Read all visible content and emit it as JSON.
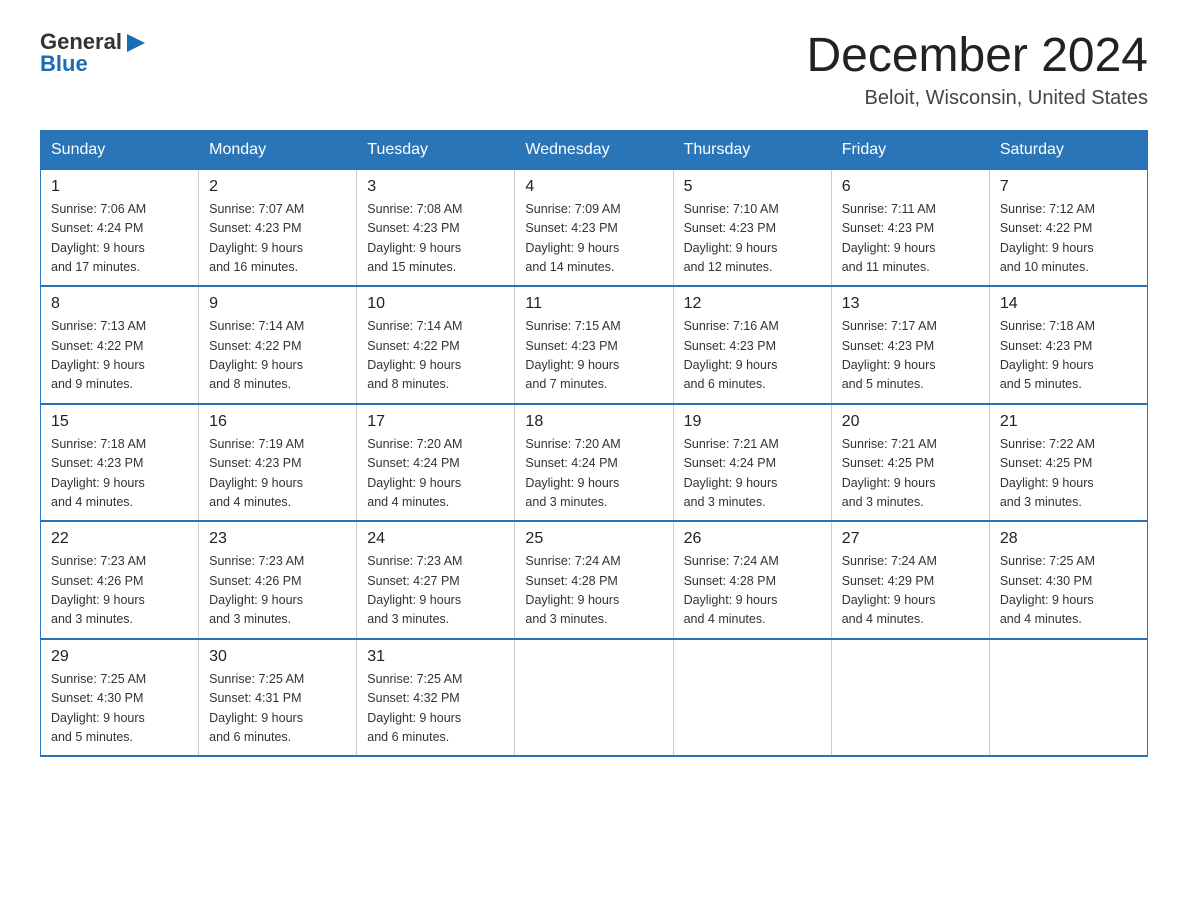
{
  "logo": {
    "general": "General",
    "blue": "Blue"
  },
  "title": "December 2024",
  "location": "Beloit, Wisconsin, United States",
  "days_of_week": [
    "Sunday",
    "Monday",
    "Tuesday",
    "Wednesday",
    "Thursday",
    "Friday",
    "Saturday"
  ],
  "weeks": [
    [
      {
        "day": "1",
        "info": "Sunrise: 7:06 AM\nSunset: 4:24 PM\nDaylight: 9 hours\nand 17 minutes."
      },
      {
        "day": "2",
        "info": "Sunrise: 7:07 AM\nSunset: 4:23 PM\nDaylight: 9 hours\nand 16 minutes."
      },
      {
        "day": "3",
        "info": "Sunrise: 7:08 AM\nSunset: 4:23 PM\nDaylight: 9 hours\nand 15 minutes."
      },
      {
        "day": "4",
        "info": "Sunrise: 7:09 AM\nSunset: 4:23 PM\nDaylight: 9 hours\nand 14 minutes."
      },
      {
        "day": "5",
        "info": "Sunrise: 7:10 AM\nSunset: 4:23 PM\nDaylight: 9 hours\nand 12 minutes."
      },
      {
        "day": "6",
        "info": "Sunrise: 7:11 AM\nSunset: 4:23 PM\nDaylight: 9 hours\nand 11 minutes."
      },
      {
        "day": "7",
        "info": "Sunrise: 7:12 AM\nSunset: 4:22 PM\nDaylight: 9 hours\nand 10 minutes."
      }
    ],
    [
      {
        "day": "8",
        "info": "Sunrise: 7:13 AM\nSunset: 4:22 PM\nDaylight: 9 hours\nand 9 minutes."
      },
      {
        "day": "9",
        "info": "Sunrise: 7:14 AM\nSunset: 4:22 PM\nDaylight: 9 hours\nand 8 minutes."
      },
      {
        "day": "10",
        "info": "Sunrise: 7:14 AM\nSunset: 4:22 PM\nDaylight: 9 hours\nand 8 minutes."
      },
      {
        "day": "11",
        "info": "Sunrise: 7:15 AM\nSunset: 4:23 PM\nDaylight: 9 hours\nand 7 minutes."
      },
      {
        "day": "12",
        "info": "Sunrise: 7:16 AM\nSunset: 4:23 PM\nDaylight: 9 hours\nand 6 minutes."
      },
      {
        "day": "13",
        "info": "Sunrise: 7:17 AM\nSunset: 4:23 PM\nDaylight: 9 hours\nand 5 minutes."
      },
      {
        "day": "14",
        "info": "Sunrise: 7:18 AM\nSunset: 4:23 PM\nDaylight: 9 hours\nand 5 minutes."
      }
    ],
    [
      {
        "day": "15",
        "info": "Sunrise: 7:18 AM\nSunset: 4:23 PM\nDaylight: 9 hours\nand 4 minutes."
      },
      {
        "day": "16",
        "info": "Sunrise: 7:19 AM\nSunset: 4:23 PM\nDaylight: 9 hours\nand 4 minutes."
      },
      {
        "day": "17",
        "info": "Sunrise: 7:20 AM\nSunset: 4:24 PM\nDaylight: 9 hours\nand 4 minutes."
      },
      {
        "day": "18",
        "info": "Sunrise: 7:20 AM\nSunset: 4:24 PM\nDaylight: 9 hours\nand 3 minutes."
      },
      {
        "day": "19",
        "info": "Sunrise: 7:21 AM\nSunset: 4:24 PM\nDaylight: 9 hours\nand 3 minutes."
      },
      {
        "day": "20",
        "info": "Sunrise: 7:21 AM\nSunset: 4:25 PM\nDaylight: 9 hours\nand 3 minutes."
      },
      {
        "day": "21",
        "info": "Sunrise: 7:22 AM\nSunset: 4:25 PM\nDaylight: 9 hours\nand 3 minutes."
      }
    ],
    [
      {
        "day": "22",
        "info": "Sunrise: 7:23 AM\nSunset: 4:26 PM\nDaylight: 9 hours\nand 3 minutes."
      },
      {
        "day": "23",
        "info": "Sunrise: 7:23 AM\nSunset: 4:26 PM\nDaylight: 9 hours\nand 3 minutes."
      },
      {
        "day": "24",
        "info": "Sunrise: 7:23 AM\nSunset: 4:27 PM\nDaylight: 9 hours\nand 3 minutes."
      },
      {
        "day": "25",
        "info": "Sunrise: 7:24 AM\nSunset: 4:28 PM\nDaylight: 9 hours\nand 3 minutes."
      },
      {
        "day": "26",
        "info": "Sunrise: 7:24 AM\nSunset: 4:28 PM\nDaylight: 9 hours\nand 4 minutes."
      },
      {
        "day": "27",
        "info": "Sunrise: 7:24 AM\nSunset: 4:29 PM\nDaylight: 9 hours\nand 4 minutes."
      },
      {
        "day": "28",
        "info": "Sunrise: 7:25 AM\nSunset: 4:30 PM\nDaylight: 9 hours\nand 4 minutes."
      }
    ],
    [
      {
        "day": "29",
        "info": "Sunrise: 7:25 AM\nSunset: 4:30 PM\nDaylight: 9 hours\nand 5 minutes."
      },
      {
        "day": "30",
        "info": "Sunrise: 7:25 AM\nSunset: 4:31 PM\nDaylight: 9 hours\nand 6 minutes."
      },
      {
        "day": "31",
        "info": "Sunrise: 7:25 AM\nSunset: 4:32 PM\nDaylight: 9 hours\nand 6 minutes."
      },
      null,
      null,
      null,
      null
    ]
  ]
}
